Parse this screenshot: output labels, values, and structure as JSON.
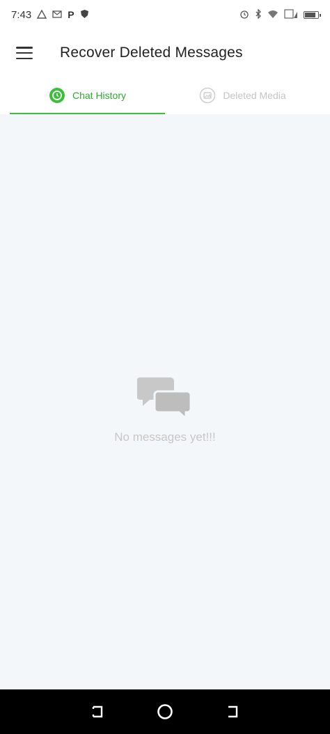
{
  "status_bar": {
    "time": "7:43",
    "left_icons": [
      "warning-icon",
      "mail-icon",
      "p-icon",
      "shield-icon"
    ],
    "p_label": "P",
    "right_icons": [
      "alarm-icon",
      "bluetooth-icon",
      "wifi-icon",
      "signal-icon",
      "battery-icon"
    ]
  },
  "app_bar": {
    "title": "Recover Deleted Messages"
  },
  "tabs": [
    {
      "label": "Chat History",
      "icon": "chat-history-icon",
      "active": true
    },
    {
      "label": "Deleted Media",
      "icon": "deleted-media-icon",
      "active": false
    }
  ],
  "empty_state": {
    "icon": "chat-bubbles-icon",
    "text": "No messages yet!!!"
  },
  "nav_bar": {
    "buttons": [
      "recents-button",
      "home-button",
      "back-button"
    ]
  },
  "colors": {
    "accent": "#3bbf3b",
    "inactive_tab": "#c4c4c4",
    "content_bg": "#f4f7f9",
    "empty_text": "#c6c6c6"
  }
}
